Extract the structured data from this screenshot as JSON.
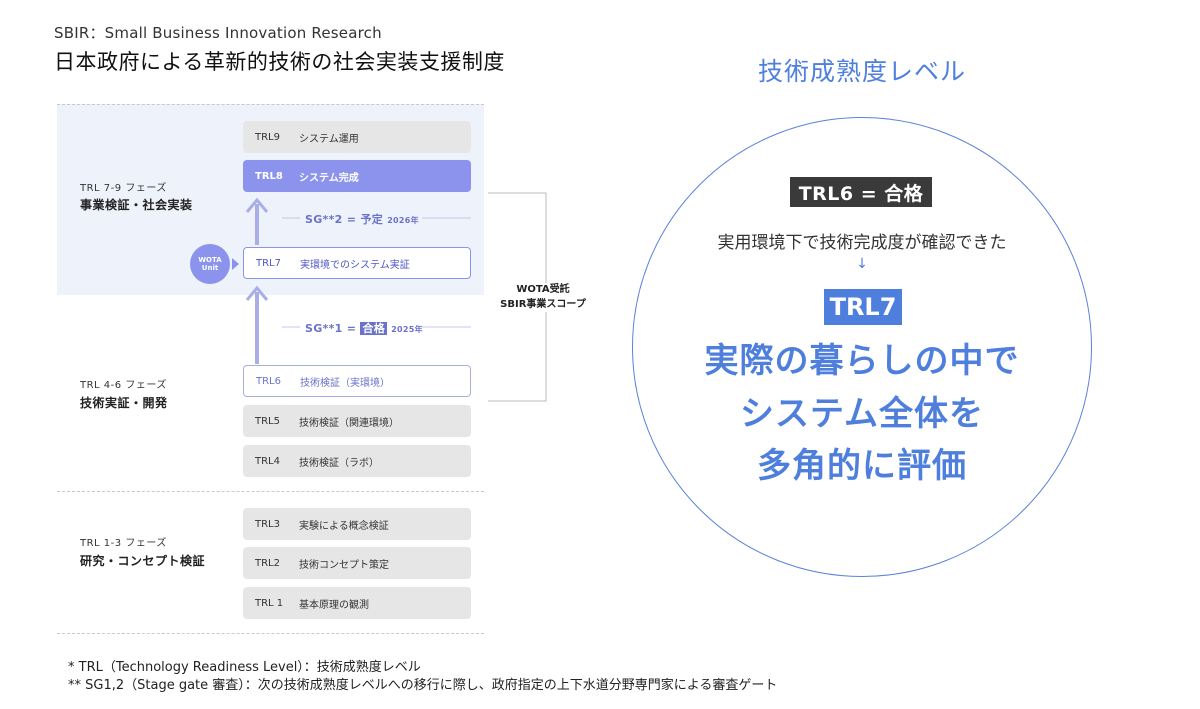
{
  "header": {
    "subtitle": "SBIR：Small Business Innovation Research",
    "title": "日本政府による革新的技術の社会実装支援制度"
  },
  "phases": [
    {
      "label": "TRL 7-9 フェーズ",
      "name": "事業検証・社会実装"
    },
    {
      "label": "TRL 4-6 フェーズ",
      "name": "技術実証・開発"
    },
    {
      "label": "TRL 1-3 フェーズ",
      "name": "研究・コンセプト検証"
    }
  ],
  "trl_levels": [
    {
      "code": "TRL9",
      "label": "システム運用"
    },
    {
      "code": "TRL8",
      "label": "システム完成"
    },
    {
      "code": "TRL7",
      "label": "実環境でのシステム実証"
    },
    {
      "code": "TRL6",
      "label": "技術検証（実環境）"
    },
    {
      "code": "TRL5",
      "label": "技術検証（関連環境）"
    },
    {
      "code": "TRL4",
      "label": "技術検証（ラボ）"
    },
    {
      "code": "TRL3",
      "label": "実験による概念検証"
    },
    {
      "code": "TRL2",
      "label": "技術コンセプト策定"
    },
    {
      "code": "TRL 1",
      "label": "基本原理の観測"
    }
  ],
  "stage_gates": [
    {
      "name": "SG**2",
      "eq": "=",
      "status": "予定",
      "year": "2026年"
    },
    {
      "name": "SG**1",
      "eq": "=",
      "status": "合格",
      "year": "2025年"
    }
  ],
  "wota_badge": {
    "line1": "WOTA",
    "line2": "Unit"
  },
  "scope": {
    "line1": "WOTA受託",
    "line2": "SBIR事業スコープ"
  },
  "footnotes": [
    "* TRL（Technology Readiness Level）：技術成熟度レベル",
    "** SG1,2（Stage gate 審査）：次の技術成熟度レベルへの移行に際し、政府指定の上下水道分野専門家による審査ゲート"
  ],
  "right_panel": {
    "title": "技術成熟度レベル",
    "trl6_badge": "TRL6 = 合格",
    "description": "実用環境下で技術完成度が確認できた",
    "arrow": "↓",
    "trl7_badge": "TRL7",
    "lines": [
      "実際の暮らしの中で",
      "システム全体を",
      "多角的に評価"
    ]
  },
  "colors": {
    "accent_blue": "#4f7fdc",
    "trl_purple": "#8b93ec",
    "band_bg": "#eef3fb",
    "box_gray": "#e6e6e6"
  }
}
